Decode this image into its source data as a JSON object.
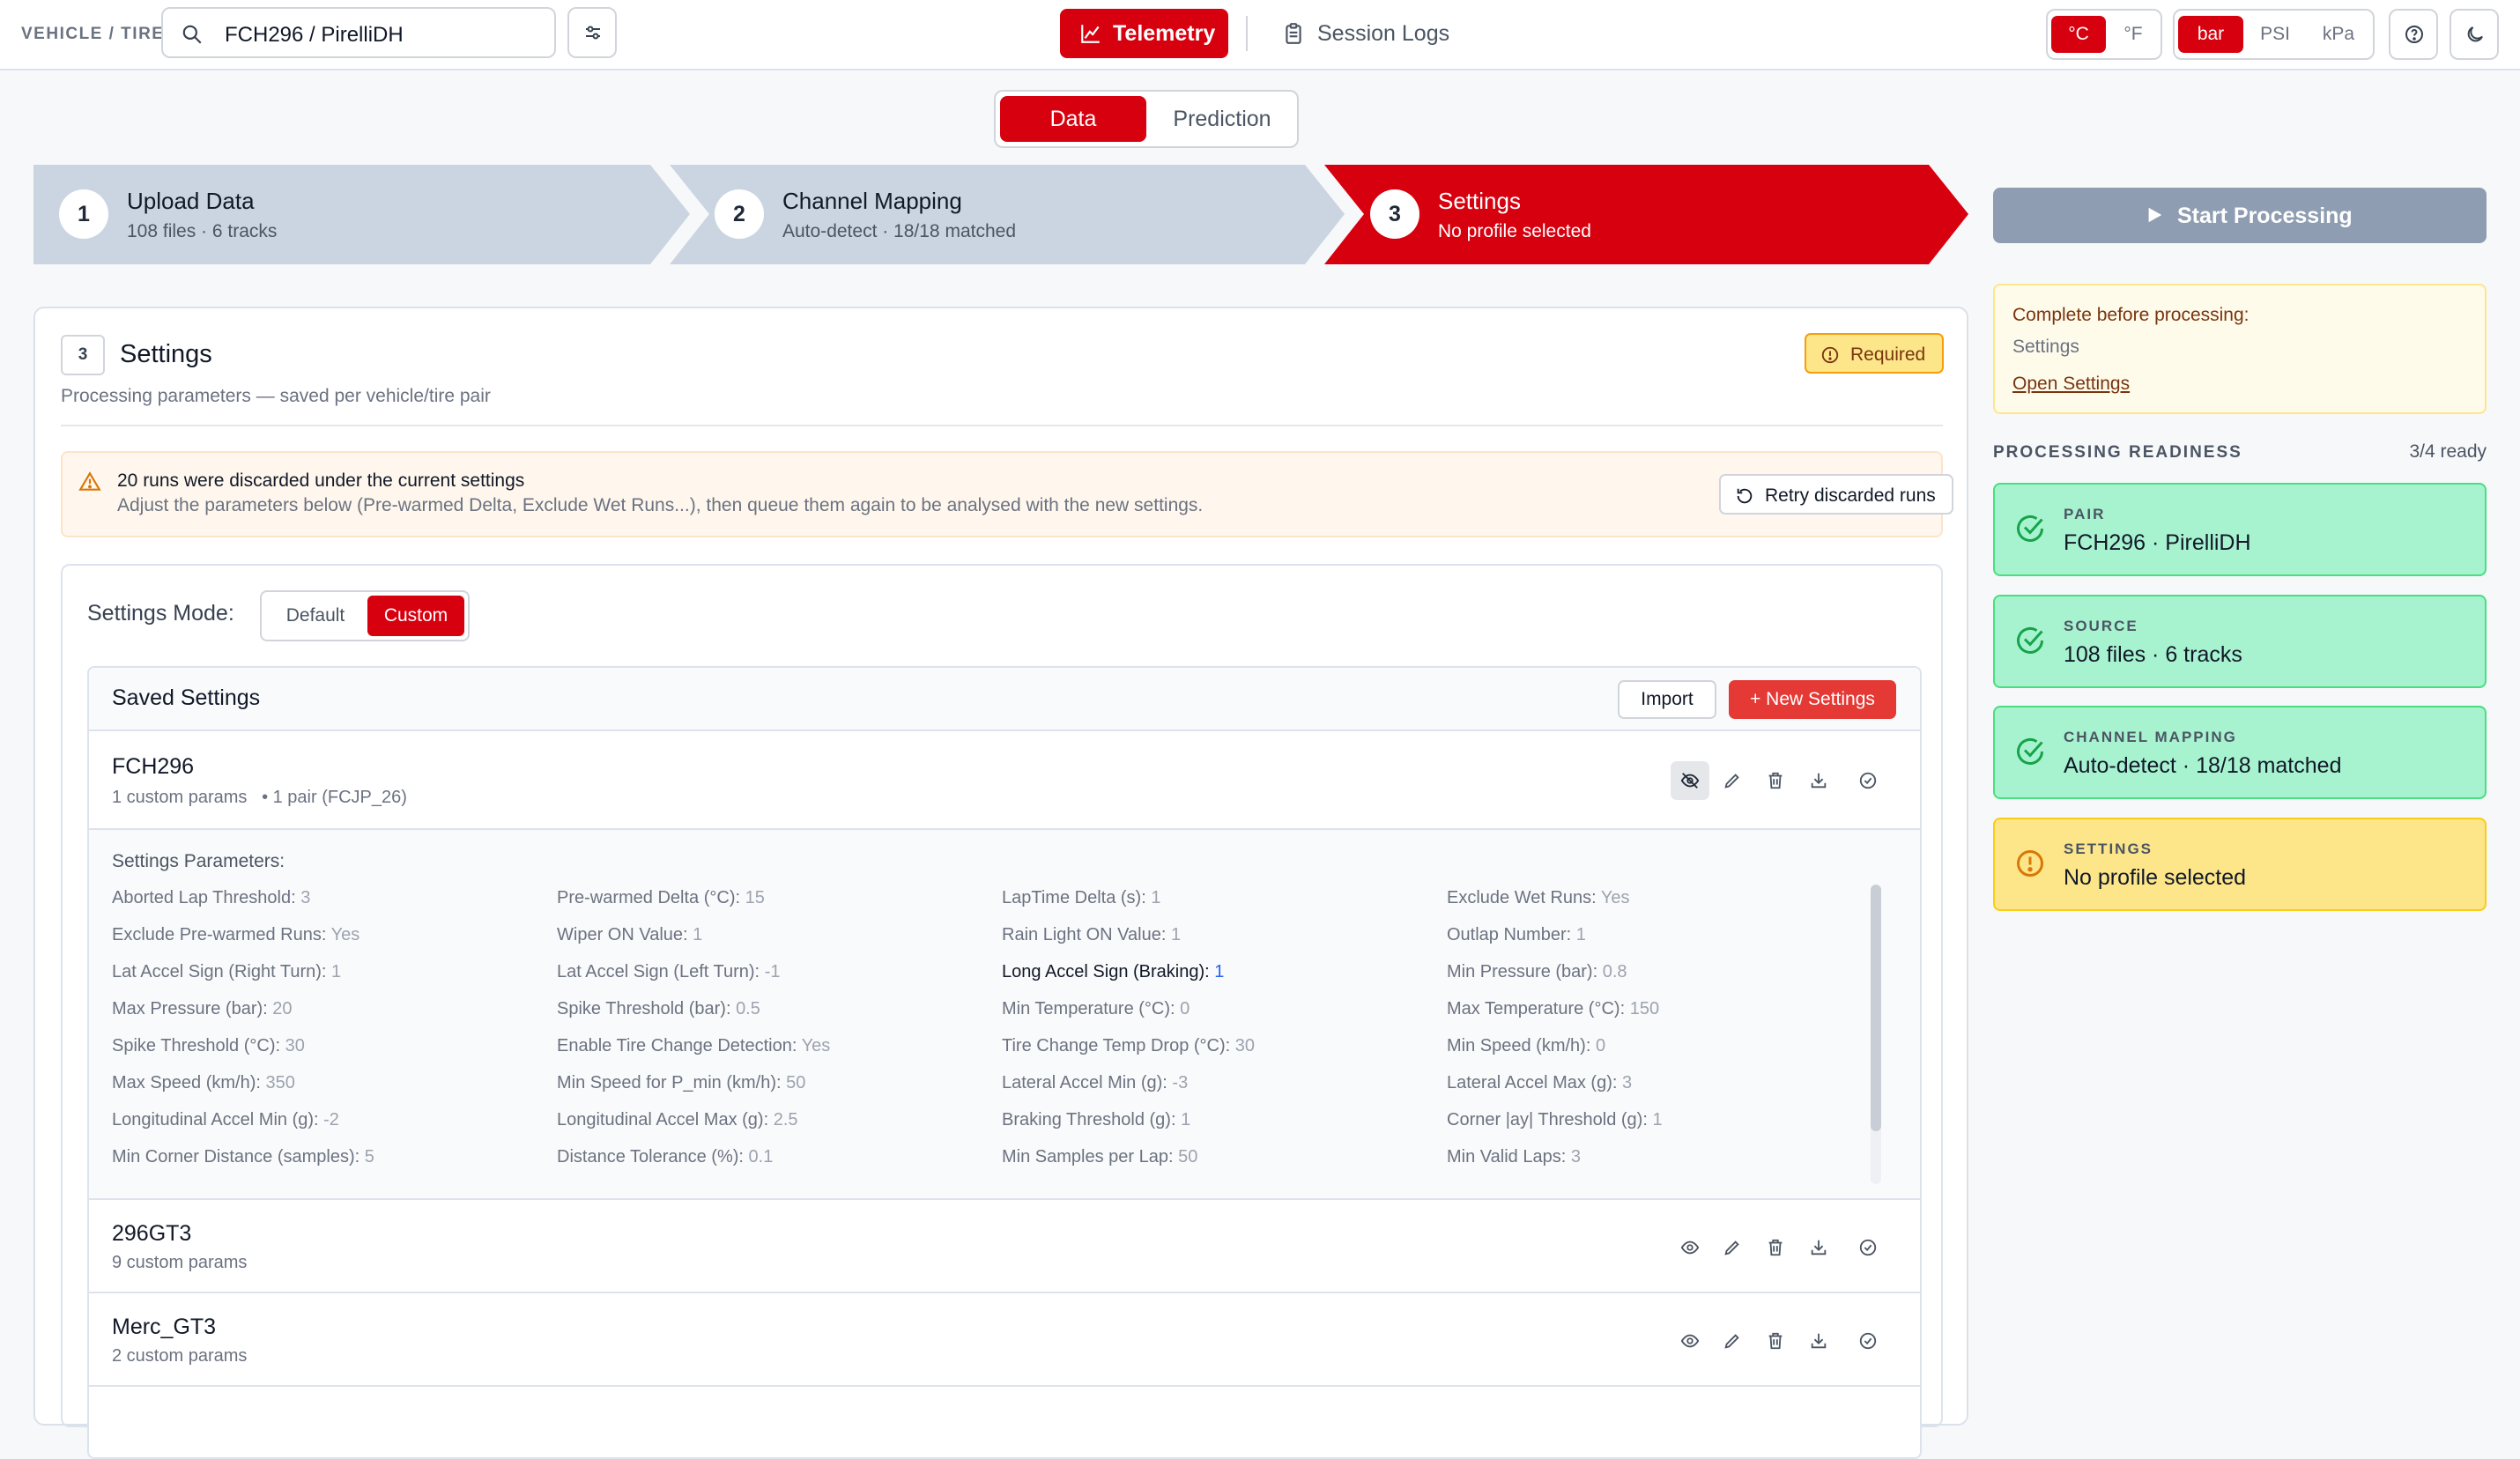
{
  "topbar": {
    "vehicle_tire_label": "VEHICLE / TIRE",
    "search_value": "FCH296 / PirelliDH",
    "telemetry_label": "Telemetry",
    "session_logs_label": "Session Logs",
    "temp_units": [
      "°C",
      "°F"
    ],
    "temp_selected": "°C",
    "pressure_units": [
      "bar",
      "PSI",
      "kPa"
    ],
    "pressure_selected": "bar"
  },
  "view_tabs": {
    "data": "Data",
    "prediction": "Prediction",
    "selected": "Data"
  },
  "stepper": [
    {
      "num": "1",
      "title": "Upload Data",
      "sub": "108 files · 6 tracks"
    },
    {
      "num": "2",
      "title": "Channel Mapping",
      "sub": "Auto-detect · 18/18 matched"
    },
    {
      "num": "3",
      "title": "Settings",
      "sub": "No profile selected"
    }
  ],
  "start_processing": "Start Processing",
  "settings_card": {
    "num": "3",
    "title": "Settings",
    "subtitle": "Processing parameters — saved per vehicle/tire pair",
    "required": "Required",
    "warning_title": "20 runs were discarded under the current settings",
    "warning_body": "Adjust the parameters below (Pre-warmed Delta, Exclude Wet Runs...), then queue them again to be analysed with the new settings.",
    "retry_label": "Retry discarded runs",
    "mode_label": "Settings Mode:",
    "mode_default": "Default",
    "mode_custom": "Custom",
    "mode_selected": "Custom",
    "saved_title": "Saved Settings",
    "import_label": "Import",
    "new_settings_label": "+ New Settings",
    "profiles": [
      {
        "name": "FCH296",
        "meta": "1 custom params",
        "pair": "• 1 pair (FCJP_26)"
      },
      {
        "name": "296GT3",
        "meta": "9 custom params"
      },
      {
        "name": "Merc_GT3",
        "meta": "2 custom params"
      }
    ],
    "params_header": "Settings Parameters:",
    "params": [
      {
        "label": "Aborted Lap Threshold:",
        "value": "3"
      },
      {
        "label": "Pre-warmed Delta (°C):",
        "value": "15"
      },
      {
        "label": "LapTime Delta (s):",
        "value": "1"
      },
      {
        "label": "Exclude Wet Runs:",
        "value": "Yes"
      },
      {
        "label": "Exclude Pre-warmed Runs:",
        "value": "Yes"
      },
      {
        "label": "Wiper ON Value:",
        "value": "1"
      },
      {
        "label": "Rain Light ON Value:",
        "value": "1"
      },
      {
        "label": "Outlap Number:",
        "value": "1"
      },
      {
        "label": "Lat Accel Sign (Right Turn):",
        "value": "1"
      },
      {
        "label": "Lat Accel Sign (Left Turn):",
        "value": "-1"
      },
      {
        "label": "Long Accel Sign (Braking):",
        "value": "1"
      },
      {
        "label": "Min Pressure (bar):",
        "value": "0.8"
      },
      {
        "label": "Max Pressure (bar):",
        "value": "20"
      },
      {
        "label": "Spike Threshold (bar):",
        "value": "0.5"
      },
      {
        "label": "Min Temperature (°C):",
        "value": "0"
      },
      {
        "label": "Max Temperature (°C):",
        "value": "150"
      },
      {
        "label": "Spike Threshold (°C):",
        "value": "30"
      },
      {
        "label": "Enable Tire Change Detection:",
        "value": "Yes"
      },
      {
        "label": "Tire Change Temp Drop (°C):",
        "value": "30"
      },
      {
        "label": "Min Speed (km/h):",
        "value": "0"
      },
      {
        "label": "Max Speed (km/h):",
        "value": "350"
      },
      {
        "label": "Min Speed for P_min (km/h):",
        "value": "50"
      },
      {
        "label": "Lateral Accel Min (g):",
        "value": "-3"
      },
      {
        "label": "Lateral Accel Max (g):",
        "value": "3"
      },
      {
        "label": "Longitudinal Accel Min (g):",
        "value": "-2"
      },
      {
        "label": "Longitudinal Accel Max (g):",
        "value": "2.5"
      },
      {
        "label": "Braking Threshold (g):",
        "value": "1"
      },
      {
        "label": "Corner |ay| Threshold (g):",
        "value": "1"
      },
      {
        "label": "Min Corner Distance (samples):",
        "value": "5"
      },
      {
        "label": "Distance Tolerance (%):",
        "value": "0.1"
      },
      {
        "label": "Min Samples per Lap:",
        "value": "50"
      },
      {
        "label": "Min Valid Laps:",
        "value": "3"
      }
    ]
  },
  "sidebar": {
    "complete_title": "Complete before processing:",
    "complete_item": "Settings",
    "open_settings": "Open Settings",
    "readiness_title": "PROCESSING READINESS",
    "readiness_count": "3/4 ready",
    "cards": [
      {
        "label": "PAIR",
        "value": "FCH296 · PirelliDH",
        "status": "ok"
      },
      {
        "label": "SOURCE",
        "value": "108 files · 6 tracks",
        "status": "ok"
      },
      {
        "label": "CHANNEL MAPPING",
        "value": "Auto-detect · 18/18 matched",
        "status": "ok"
      },
      {
        "label": "SETTINGS",
        "value": "No profile selected",
        "status": "warning"
      }
    ]
  },
  "colors": {
    "accent": "#d7000f",
    "ready_bg": "#a7f3d0",
    "warning_bg": "#fde68a",
    "step_inactive": "#cbd5e1"
  }
}
